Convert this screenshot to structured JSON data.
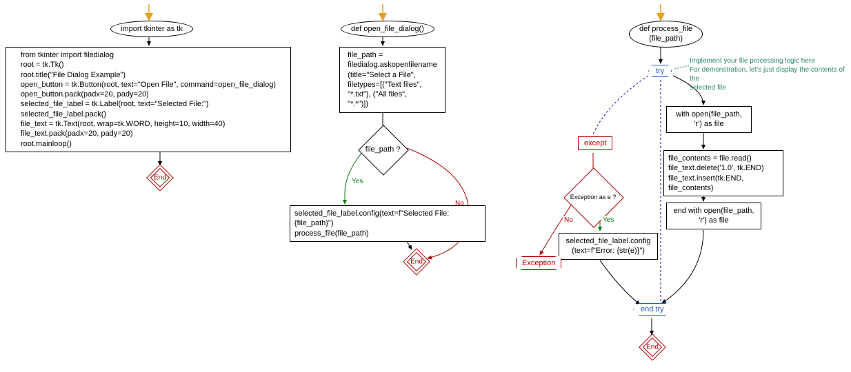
{
  "flow1": {
    "start": "import tkinter as tk",
    "body": "from tkinter import filedialog\nroot = tk.Tk()\nroot.title(\"File Dialog Example\")\nopen_button = tk.Button(root, text=\"Open File\", command=open_file_dialog)\nopen_button.pack(padx=20, pady=20)\nselected_file_label = tk.Label(root, text=\"Selected File:\")\nselected_file_label.pack()\nfile_text = tk.Text(root, wrap=tk.WORD, height=10, width=40)\nfile_text.pack(padx=20, pady=20)\nroot.mainloop()",
    "end": "End"
  },
  "flow2": {
    "start": "def open_file_dialog()",
    "body1": "file_path =\nfiledialog.askopenfilename\n(title=\"Select a File\",\nfiletypes=[(\"Text files\",\n\"*.txt\"), (\"All files\",\n\"*.*\")])",
    "cond": "file_path ?",
    "yes": "Yes",
    "no": "No",
    "body2": "selected_file_label.config(text=f\"Selected File: {file_path}\")\nprocess_file(file_path)",
    "end": "End"
  },
  "flow3": {
    "start": "def process_file\n(file_path)",
    "try": "try",
    "endtry": "end try",
    "comment": "Implement your file processing logic here\nFor demonstration, let's just display the contents of the\nselected file",
    "with1": "with open(file_path,\n'r') as file",
    "body1": "file_contents = file.read()\nfile_text.delete('1.0', tk.END)\nfile_text.insert(tk.END, file_contents)",
    "with2": "end with open(file_path,\n'r') as file",
    "except": "except",
    "cond": "Exception as e ?",
    "yes": "Yes",
    "no": "No",
    "body2": "selected_file_label.config\n(text=f\"Error: {str(e)}\")",
    "exception": "Exception",
    "end": "End"
  }
}
